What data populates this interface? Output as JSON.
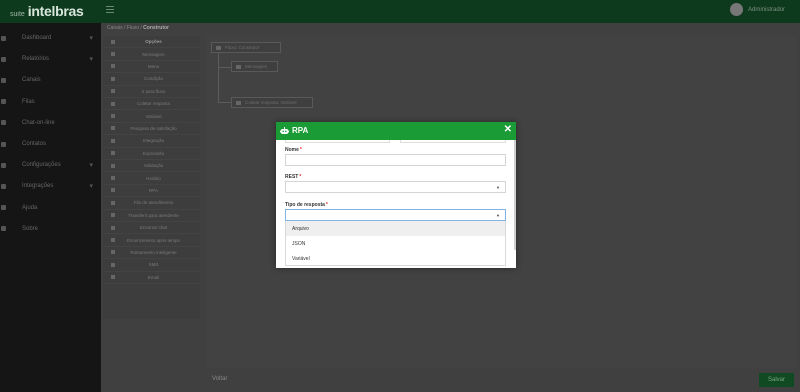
{
  "brand": {
    "small": "suite",
    "name": "intelbras"
  },
  "user": {
    "name": "Administrador"
  },
  "sidebar": {
    "items": [
      {
        "label": "Dashboard",
        "has_children": true
      },
      {
        "label": "Relatórios",
        "has_children": true
      },
      {
        "label": "Canais",
        "has_children": false
      },
      {
        "label": "Filas",
        "has_children": false
      },
      {
        "label": "Chat-on-line",
        "has_children": false
      },
      {
        "label": "Contatos",
        "has_children": false
      },
      {
        "label": "Configurações",
        "has_children": true
      },
      {
        "label": "Integrações",
        "has_children": true
      },
      {
        "label": "Ajuda",
        "has_children": false
      },
      {
        "label": "Sobre",
        "has_children": false
      }
    ]
  },
  "breadcrumb": {
    "part1": "Canais",
    "sep": "/",
    "part2": "Fluxo",
    "part3": "Construtor"
  },
  "palette": {
    "header": "Opções",
    "items": [
      "Mensagem",
      "Menu",
      "Condição",
      "Ir para fluxo",
      "Coletar resposta",
      "Variável",
      "Pesquisa de satisfação",
      "Integração",
      "Expressão",
      "Validação",
      "Horário",
      "RPA",
      "Fila de atendimento",
      "Transferir para atendente",
      "Encerrar chat",
      "Encerramento após tempo",
      "Roteamento inteligente",
      "SMS",
      "Email"
    ]
  },
  "canvas": {
    "nodes": [
      "Fluxo: Construtor",
      "Mensagem",
      "Coletar resposta: Variável"
    ]
  },
  "footer": {
    "back": "Voltar",
    "save": "Salvar"
  },
  "modal": {
    "title": "RPA",
    "fields": {
      "name_label": "Nome",
      "rest_label": "REST",
      "type_label": "Tipo de resposta"
    },
    "required_mark": "*",
    "dropdown_options": [
      "Arquivo",
      "JSON",
      "Variável"
    ],
    "highlighted_option": "Arquivo"
  },
  "colors": {
    "accent": "#1a9b36",
    "topbar": "#0d3a1d",
    "required": "#e22222"
  }
}
